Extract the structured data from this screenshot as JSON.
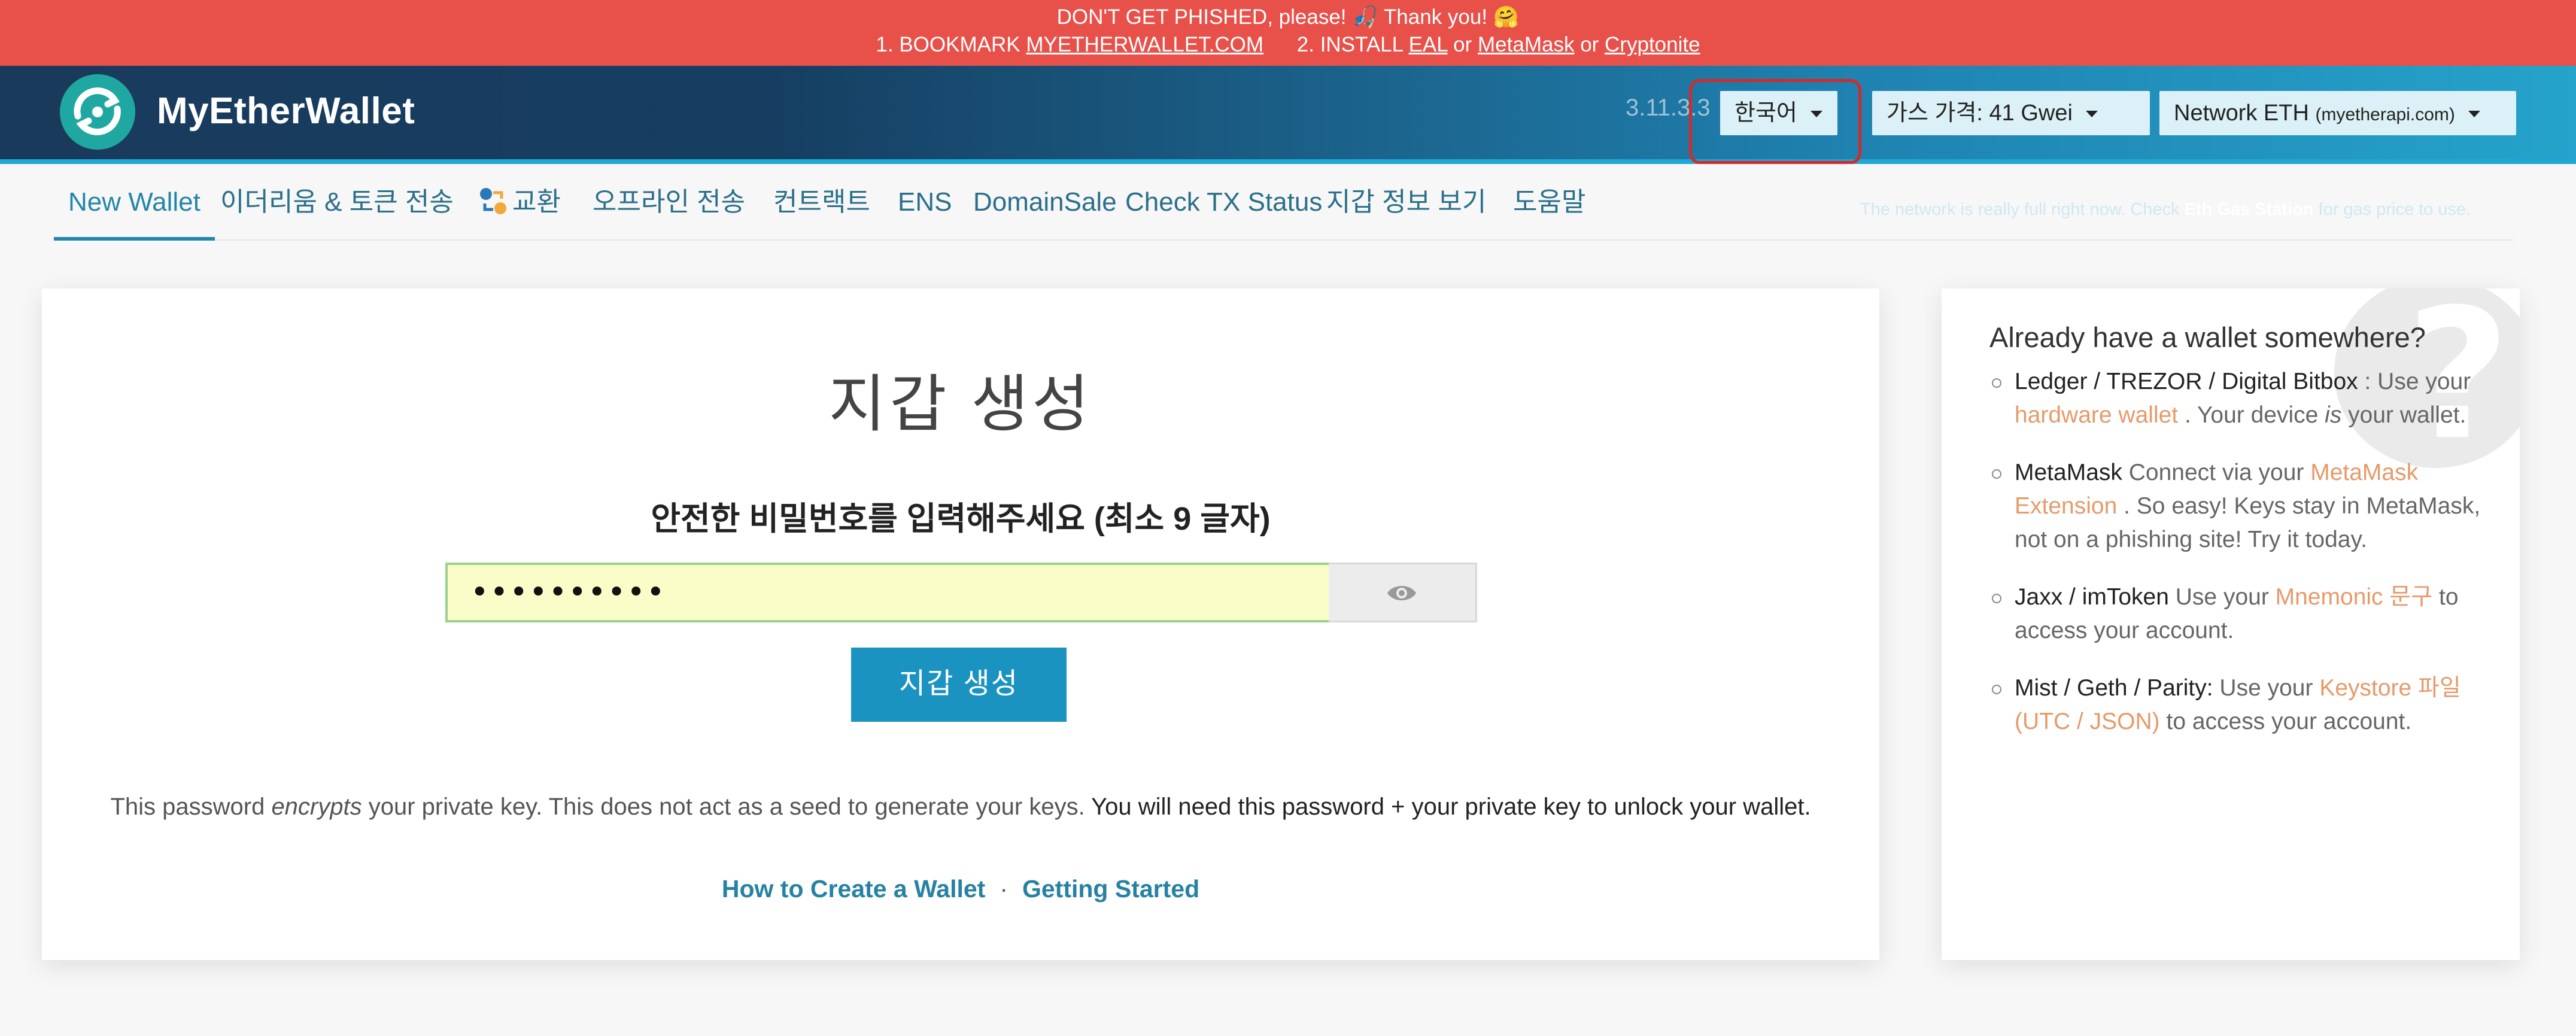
{
  "banner": {
    "line1": "DON'T GET PHISHED, please! 🎣 Thank you! 🤗",
    "step1_prefix": "1. BOOKMARK",
    "step1_link": "MYETHERWALLET.COM",
    "step2_prefix": "2. INSTALL",
    "step2_link1": "EAL",
    "or1": "or",
    "step2_link2": "MetaMask",
    "or2": "or",
    "step2_link3": "Cryptonite"
  },
  "header": {
    "brand": "MyEtherWallet",
    "version": "3.11.3.3",
    "language": "한국어",
    "gas_price": "가스 가격: 41 Gwei",
    "network_label": "Network ETH",
    "network_node": "(myetherapi.com)",
    "gas_note_prefix": "The network is really full right now. Check",
    "gas_note_link": "Eth Gas Station",
    "gas_note_suffix": "for gas price to use."
  },
  "nav": {
    "items": [
      {
        "label": "New Wallet",
        "active": true
      },
      {
        "label": "이더리움 & 토큰 전송"
      },
      {
        "label": "교환"
      },
      {
        "label": "오프라인 전송"
      },
      {
        "label": "컨트랙트"
      },
      {
        "label": "ENS"
      },
      {
        "label": "DomainSale"
      },
      {
        "label": "Check TX Status"
      },
      {
        "label": "지갑 정보 보기"
      },
      {
        "label": "도움말"
      }
    ]
  },
  "main": {
    "title": "지갑 생성",
    "password_label": "안전한 비밀번호를 입력해주세요 (최소 9 글자)",
    "password_value": "••••••••••",
    "create_button": "지갑 생성",
    "note_part1": "This password",
    "note_em": "encrypts",
    "note_part2": "your private key. This does not act as a seed to generate your keys.",
    "note_bold": "You will need this password + your private key to unlock your wallet.",
    "link1": "How to Create a Wallet",
    "separator": "·",
    "link2": "Getting Started"
  },
  "side": {
    "title": "Already have a wallet somewhere?",
    "items": [
      {
        "strong": "Ledger / TREZOR / Digital Bitbox",
        "t1": " : Use your ",
        "link": "hardware wallet",
        "t2": " . Your device ",
        "em": "is",
        "t3": " your wallet."
      },
      {
        "strong": "MetaMask",
        "t1": " Connect via your ",
        "link": "MetaMask Extension",
        "t2": " . So easy! Keys stay in MetaMask, not on a phishing site! Try it today."
      },
      {
        "strong": "Jaxx / imToken",
        "t1": " Use your ",
        "link": "Mnemonic 문구",
        "t2": " to access your account."
      },
      {
        "strong": "Mist / Geth / Parity:",
        "t1": " Use your ",
        "link": "Keystore 파일 (UTC / JSON)",
        "t2": " to access your account."
      }
    ],
    "help_glyph": "?"
  },
  "colors": {
    "banner": "#e8504a",
    "accent": "#1b93c1",
    "link": "#2681a3",
    "side_link": "#e69a6a",
    "highlight": "#d42a2a"
  }
}
